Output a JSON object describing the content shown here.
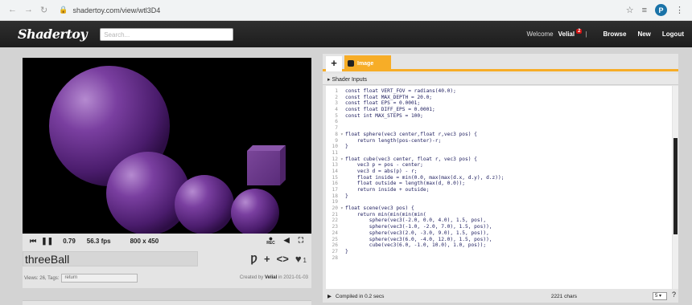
{
  "browser": {
    "url": "shadertoy.com/view/wtl3D4",
    "profile_initial": "P"
  },
  "header": {
    "logo": "Shadertoy",
    "search_placeholder": "Search...",
    "welcome": "Welcome",
    "username": "Velial",
    "notification_count": "2",
    "nav_browse": "Browse",
    "nav_new": "New",
    "nav_logout": "Logout"
  },
  "player": {
    "time": "0.79",
    "fps": "56.3 fps",
    "resolution": "800 x 450",
    "rec_label": "REC"
  },
  "shader": {
    "title": "threeBall",
    "views_tags_label": "Views: 26, Tags:",
    "tag_value": "return",
    "like_count": "1",
    "created_prefix": "Created by",
    "author": "Velial",
    "created_suffix": "in 2021-01-03"
  },
  "editor": {
    "add_tab": "+",
    "tab_image": "Image",
    "shader_inputs": "Shader Inputs",
    "compiled": "Compiled in 0.2 secs",
    "chars": "2221 chars",
    "font_size": "5"
  },
  "code_lines": [
    "const float VERT_FOV = radians(40.0);",
    "const float MAX_DEPTH = 20.0;",
    "const float EPS = 0.0001;",
    "const float DIFF_EPS = 0.0001;",
    "const int MAX_STEPS = 100;",
    "",
    "",
    "float sphere(vec3 center,float r,vec3 pos) {",
    "    return length(pos-center)-r;",
    "}",
    "",
    "float cube(vec3 center, float r, vec3 pos) {",
    "    vec3 p = pos - center;",
    "    vec3 d = abs(p) - r;",
    "    float inside = min(0.0, max(max(d.x, d.y), d.z));",
    "    float outside = length(max(d, 0.0));",
    "    return inside + outside;",
    "}",
    "",
    "float scene(vec3 pos) {",
    "    return min(min(min(min(",
    "        sphere(vec3(-2.0, 0.0, 4.0), 1.5, pos),",
    "        sphere(vec3(-1.0, -2.0, 7.0), 1.5, pos)),",
    "        sphere(vec3(2.0, -3.0, 9.0), 1.5, pos)),",
    "        sphere(vec3(6.0, -4.0, 12.0), 1.5, pos)),",
    "        cube(vec3(6.0, -1.0, 10.0), 1.0, pos));",
    "}",
    ""
  ],
  "fold_lines": [
    8,
    12,
    20
  ]
}
